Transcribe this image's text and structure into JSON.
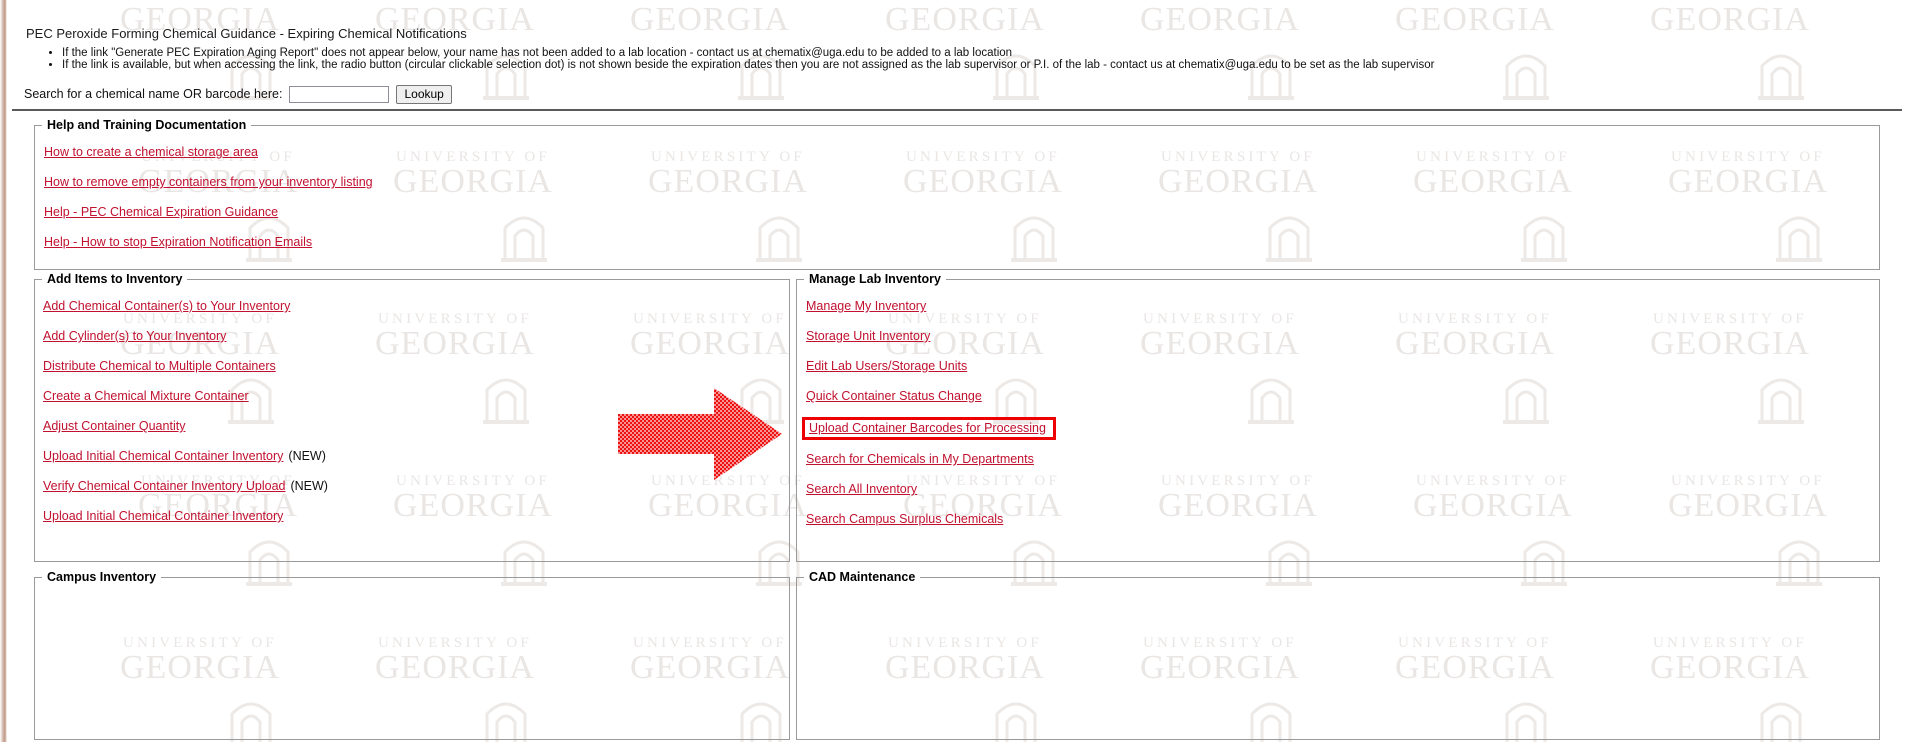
{
  "page": {
    "title": "PEC Peroxide Forming Chemical Guidance - Expiring Chemical Notifications",
    "notices": [
      "If the link \"Generate PEC Expiration Aging Report\" does not appear below, your name has not been added to a lab location - contact us at chematix@uga.edu to be added to a lab location",
      "If the link is available, but when accessing the link, the radio button (circular clickable selection dot) is not shown beside the expiration dates then you are not assigned as the lab supervisor or P.I. of the lab - contact us at chematix@uga.edu to be set as the lab supervisor"
    ]
  },
  "search": {
    "label": "Search for a chemical name OR barcode here:",
    "value": "",
    "placeholder": "",
    "button_label": "Lookup"
  },
  "sections": {
    "help": {
      "legend": "Help and Training Documentation",
      "links": [
        "How to create a chemical storage area",
        "How to remove empty containers from your inventory listing",
        "Help - PEC Chemical Expiration Guidance",
        "Help - How to stop Expiration Notification Emails"
      ]
    },
    "add_items": {
      "legend": "Add Items to Inventory",
      "links": [
        {
          "label": "Add Chemical Container(s) to Your Inventory",
          "tag": ""
        },
        {
          "label": "Add Cylinder(s) to Your Inventory",
          "tag": ""
        },
        {
          "label": "Distribute Chemical to Multiple Containers",
          "tag": ""
        },
        {
          "label": "Create a Chemical Mixture Container",
          "tag": ""
        },
        {
          "label": "Adjust Container Quantity",
          "tag": ""
        },
        {
          "label": "Upload Initial Chemical Container Inventory",
          "tag": "(NEW)"
        },
        {
          "label": "Verify Chemical Container Inventory Upload",
          "tag": "(NEW)"
        },
        {
          "label": "Upload Initial Chemical Container Inventory",
          "tag": ""
        }
      ]
    },
    "manage_lab": {
      "legend": "Manage Lab Inventory",
      "links": [
        {
          "label": "Manage My Inventory",
          "highlighted": false
        },
        {
          "label": "Storage Unit Inventory",
          "highlighted": false
        },
        {
          "label": "Edit Lab Users/Storage Units",
          "highlighted": false
        },
        {
          "label": "Quick Container Status Change",
          "highlighted": false
        },
        {
          "label": "Upload Container Barcodes for Processing",
          "highlighted": true
        },
        {
          "label": "Search for Chemicals in My Departments",
          "highlighted": false
        },
        {
          "label": "Search All Inventory",
          "highlighted": false
        },
        {
          "label": "Search Campus Surplus Chemicals",
          "highlighted": false
        }
      ]
    },
    "campus_inventory": {
      "legend": "Campus Inventory"
    },
    "cad_maintenance": {
      "legend": "CAD Maintenance"
    }
  },
  "annotation": {
    "arrow_color": "#ee1111",
    "highlight_color": "#ee0000",
    "points_to": "Upload Container Barcodes for Processing"
  },
  "watermark": {
    "line1": "UNIVERSITY OF",
    "line2": "GEORGIA"
  },
  "colors": {
    "link": "#c1112f",
    "text": "#111111",
    "border": "#9a9a9a",
    "rule": "#5a5a5a"
  }
}
